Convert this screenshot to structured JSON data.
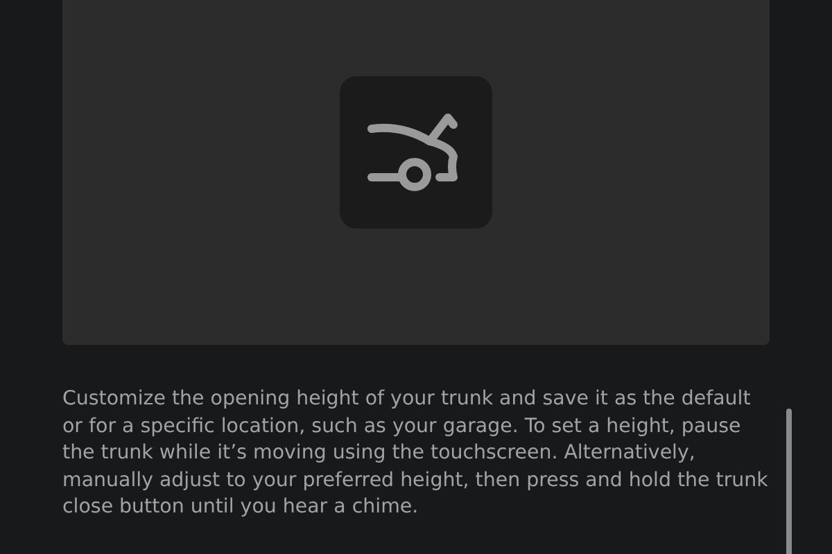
{
  "description": "Customize the opening height of your trunk and save it as the default or for a specific location, such as your garage. To set a height, pause the trunk while it’s moving using the touchscreen. Alternatively, manually adjust to your preferred height, then press and hold the trunk close button until you hear a chime."
}
